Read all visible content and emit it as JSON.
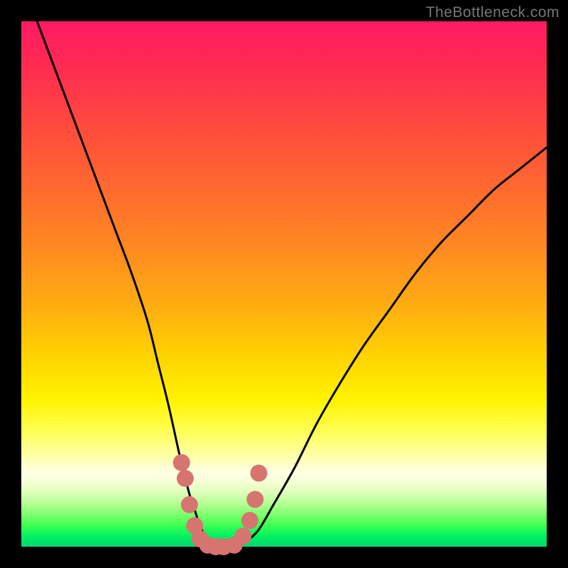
{
  "watermark": "TheBottleneck.com",
  "colors": {
    "frame": "#000000",
    "curve": "#000000",
    "markers": "#d6746f"
  },
  "chart_data": {
    "type": "line",
    "title": "",
    "xlabel": "",
    "ylabel": "",
    "xlim": [
      0,
      100
    ],
    "ylim": [
      0,
      100
    ],
    "series": [
      {
        "name": "bottleneck-curve",
        "x": [
          0,
          3,
          6,
          9,
          12,
          15,
          18,
          21,
          24,
          26,
          28,
          30,
          31,
          32,
          33,
          34,
          35,
          36,
          38,
          40,
          42,
          45,
          48,
          52,
          56,
          60,
          65,
          70,
          75,
          80,
          85,
          90,
          95,
          100
        ],
        "y": [
          108,
          100,
          92,
          84,
          76,
          68,
          60,
          52,
          43,
          35,
          27,
          18,
          14,
          10,
          7,
          4,
          2,
          0.5,
          0,
          0,
          0.5,
          3,
          8,
          15,
          23,
          30,
          38,
          45,
          52,
          58,
          63,
          68,
          72,
          76
        ]
      }
    ],
    "markers": {
      "name": "highlight-points",
      "x": [
        30.5,
        31.2,
        32.0,
        33.0,
        34.0,
        35.5,
        37.0,
        38.5,
        40.5,
        42.2,
        43.5,
        44.5,
        45.2
      ],
      "y": [
        16,
        13,
        8,
        4,
        1.5,
        0.3,
        0,
        0,
        0.3,
        2,
        5,
        9,
        14
      ]
    }
  }
}
